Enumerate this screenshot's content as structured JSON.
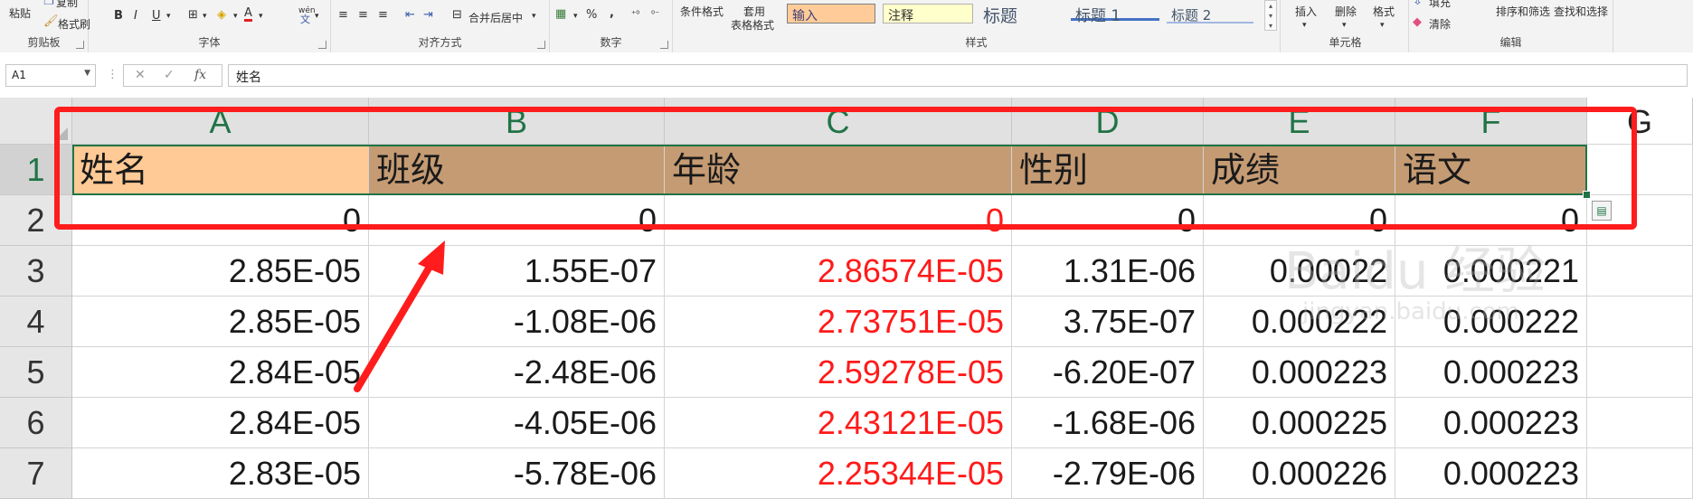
{
  "ribbon": {
    "clipboard": {
      "paste": "粘贴",
      "copy": "复制",
      "format_painter": "格式刷",
      "group": "剪贴板"
    },
    "font": {
      "bold": "B",
      "italic": "I",
      "underline": "U",
      "font_color": "A",
      "wen": "wén",
      "group": "字体"
    },
    "alignment": {
      "merge_center": "合并后居中",
      "group": "对齐方式"
    },
    "number": {
      "percent": "%",
      "comma": ",",
      "group": "数字"
    },
    "styles": {
      "conditional": "条件格式",
      "table_format_1": "套用",
      "table_format_2": "表格格式",
      "style_input": "输入",
      "style_note": "注释",
      "style_title": "标题",
      "style_h1": "标题 1",
      "style_h2": "标题 2",
      "group": "样式"
    },
    "cells": {
      "insert": "插入",
      "delete": "删除",
      "format": "格式",
      "group": "单元格"
    },
    "editing": {
      "fill": "填充",
      "clear": "清除",
      "sort_filter": "排序和筛选",
      "find_select": "查找和选择",
      "group": "编辑"
    }
  },
  "formula_bar": {
    "name_box": "A1",
    "cancel": "✕",
    "confirm": "✓",
    "fx": "fx",
    "content": "姓名"
  },
  "sheet": {
    "columns": [
      "A",
      "B",
      "C",
      "D",
      "E",
      "F",
      "G"
    ],
    "rows": [
      {
        "num": "1",
        "cells": [
          "姓名",
          "班级",
          "年龄",
          "性别",
          "成绩",
          "语文"
        ]
      },
      {
        "num": "2",
        "cells": [
          "0",
          "0",
          "0",
          "0",
          "0",
          "0"
        ]
      },
      {
        "num": "3",
        "cells": [
          "2.85E-05",
          "1.55E-07",
          "2.86574E-05",
          "1.31E-06",
          "0.00022",
          "0.000221"
        ]
      },
      {
        "num": "4",
        "cells": [
          "2.85E-05",
          "-1.08E-06",
          "2.73751E-05",
          "3.75E-07",
          "0.000222",
          "0.000222"
        ]
      },
      {
        "num": "5",
        "cells": [
          "2.84E-05",
          "-2.48E-06",
          "2.59278E-05",
          "-6.20E-07",
          "0.000223",
          "0.000223"
        ]
      },
      {
        "num": "6",
        "cells": [
          "2.84E-05",
          "-4.05E-06",
          "2.43121E-05",
          "-1.68E-06",
          "0.000225",
          "0.000223"
        ]
      },
      {
        "num": "7",
        "cells": [
          "2.83E-05",
          "-5.78E-06",
          "2.25344E-05",
          "-2.79E-06",
          "0.000226",
          "0.000223"
        ]
      }
    ]
  },
  "watermark": {
    "main": "Baidu 经验",
    "sub": "jingyan.baidu.com"
  },
  "colors": {
    "header_fill": "#c59b73",
    "active_fill": "#ffca96",
    "red_text": "#ff1a1a",
    "annotation": "#ff1c1c",
    "accent": "#217346"
  }
}
